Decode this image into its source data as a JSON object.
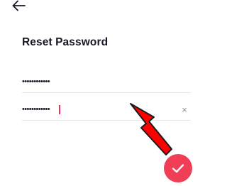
{
  "header": {
    "back_icon": "arrow-left-icon"
  },
  "page": {
    "title": "Reset Password"
  },
  "form": {
    "password_value": "••••••••••••",
    "confirm_password_value": "••••••••••••",
    "clear_icon": "×"
  },
  "actions": {
    "confirm_icon": "check-icon"
  },
  "overlay": {
    "arrow_color": "#ff0000"
  },
  "colors": {
    "accent": "#ef3e56",
    "text": "#161823",
    "divider": "#e6e6e8",
    "clear_icon": "#8a8b91"
  }
}
